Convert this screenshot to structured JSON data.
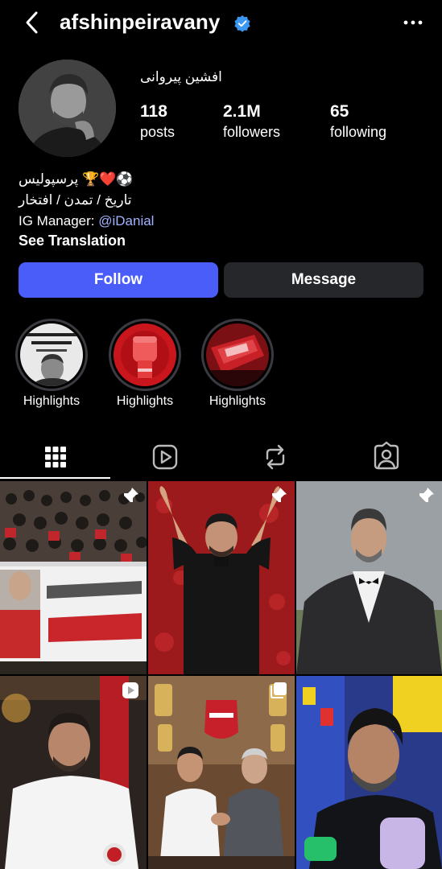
{
  "header": {
    "username": "afshinpeiravany",
    "verified": true,
    "icons": {
      "back": "chevron-left-icon",
      "verified": "verified-badge-icon",
      "more": "more-dots-icon"
    }
  },
  "profile": {
    "display_name": "افشین پیروانی",
    "stats": {
      "posts": {
        "value": "118",
        "label": "posts"
      },
      "followers": {
        "value": "2.1M",
        "label": "followers"
      },
      "following": {
        "value": "65",
        "label": "following"
      }
    },
    "bio": {
      "line1_text": "پرسپولیس 🏆❤️⚽️",
      "line2_text": "تاریخ / تمدن / افتخار",
      "line3_prefix": "IG Manager: ",
      "line3_handle": "@iDanial",
      "see_translation": "See Translation"
    }
  },
  "actions": {
    "follow_label": "Follow",
    "message_label": "Message",
    "follow_color": "#4a5df9"
  },
  "highlights": [
    {
      "label": "Highlights"
    },
    {
      "label": "Highlights"
    },
    {
      "label": "Highlights"
    }
  ],
  "tabs": [
    {
      "name": "grid",
      "icon": "grid-icon",
      "active": true
    },
    {
      "name": "reels",
      "icon": "reels-icon",
      "active": false
    },
    {
      "name": "reposts",
      "icon": "repost-icon",
      "active": false
    },
    {
      "name": "tagged",
      "icon": "tagged-person-icon",
      "active": false
    }
  ],
  "posts": [
    {
      "badge": "pin-icon"
    },
    {
      "badge": "pin-icon"
    },
    {
      "badge": "pin-icon"
    },
    {
      "badge": "reel-icon"
    },
    {
      "badge": "carousel-icon"
    },
    {
      "badge": ""
    }
  ]
}
